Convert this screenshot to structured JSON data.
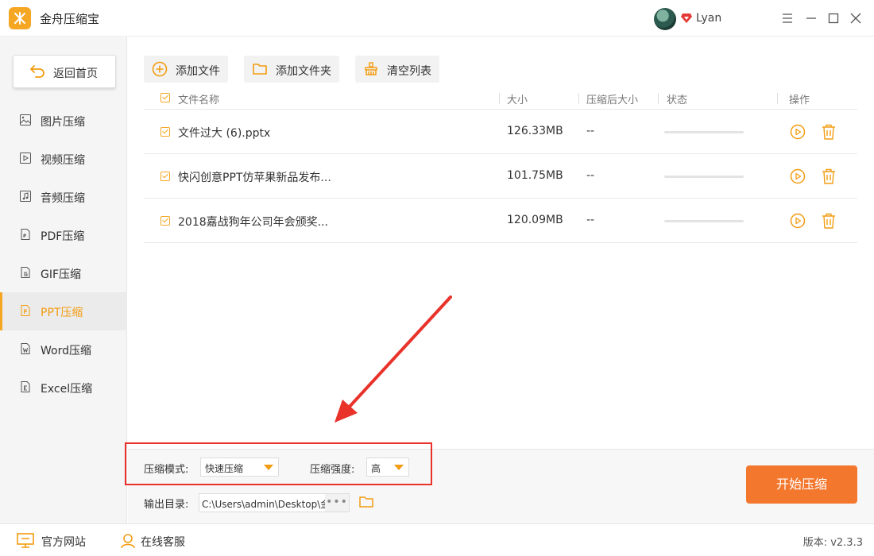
{
  "app": {
    "title": "金舟压缩宝",
    "user": "Lyan"
  },
  "sidebar": {
    "back_label": "返回首页",
    "items": [
      {
        "label": "图片压缩",
        "icon": "image-icon"
      },
      {
        "label": "视频压缩",
        "icon": "video-icon"
      },
      {
        "label": "音频压缩",
        "icon": "audio-icon"
      },
      {
        "label": "PDF压缩",
        "icon": "pdf-icon"
      },
      {
        "label": "GIF压缩",
        "icon": "gif-icon"
      },
      {
        "label": "PPT压缩",
        "icon": "ppt-icon",
        "active": true
      },
      {
        "label": "Word压缩",
        "icon": "word-icon"
      },
      {
        "label": "Excel压缩",
        "icon": "excel-icon"
      }
    ]
  },
  "toolbar": {
    "add_file": "添加文件",
    "add_folder": "添加文件夹",
    "clear_list": "清空列表"
  },
  "table": {
    "headers": {
      "name": "文件名称",
      "size": "大小",
      "compressed_size": "压缩后大小",
      "status": "状态",
      "actions": "操作"
    },
    "rows": [
      {
        "name": "文件过大 (6).pptx",
        "size": "126.33MB",
        "compressed_size": "--",
        "progress": 0
      },
      {
        "name": "快闪创意PPT仿苹果新品发布...",
        "size": "101.75MB",
        "compressed_size": "--",
        "progress": 0
      },
      {
        "name": "2018嘉战狗年公司年会颁奖...",
        "size": "120.09MB",
        "compressed_size": "--",
        "progress": 0
      }
    ]
  },
  "settings": {
    "mode_label": "压缩模式:",
    "mode_value": "快速压缩",
    "strength_label": "压缩强度:",
    "strength_value": "高",
    "output_label": "输出目录:",
    "output_path": "C:\\Users\\admin\\Desktop\\金",
    "browse_label": "•••"
  },
  "start_button": "开始压缩",
  "footer": {
    "website": "官方网站",
    "support": "在线客服",
    "version": "版本:  v2.3.3"
  },
  "colors": {
    "accent": "#f5a623",
    "start_button": "#f4772e",
    "annotation": "#e8322a"
  }
}
